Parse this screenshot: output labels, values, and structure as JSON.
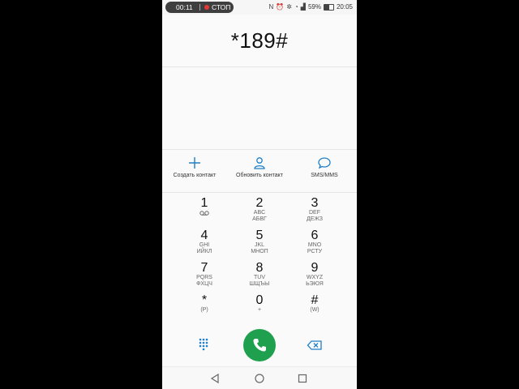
{
  "status_bar": {
    "rec_time": "00:11",
    "rec_stop": "СТОП",
    "battery": "59%",
    "clock": "20:05"
  },
  "display": {
    "number": "*189#"
  },
  "actions": [
    {
      "label": "Создать контакт",
      "icon": "plus-icon"
    },
    {
      "label": "Обновить контакт",
      "icon": "person-icon"
    },
    {
      "label": "SMS/MMS",
      "icon": "chat-bubble-icon"
    }
  ],
  "keypad": [
    {
      "digit": "1",
      "sub1": "",
      "sub2": ""
    },
    {
      "digit": "2",
      "sub1": "ABC",
      "sub2": "АБВГ"
    },
    {
      "digit": "3",
      "sub1": "DEF",
      "sub2": "ДЕЖЗ"
    },
    {
      "digit": "4",
      "sub1": "GHI",
      "sub2": "ИЙКЛ"
    },
    {
      "digit": "5",
      "sub1": "JKL",
      "sub2": "МНОП"
    },
    {
      "digit": "6",
      "sub1": "MNO",
      "sub2": "РСТУ"
    },
    {
      "digit": "7",
      "sub1": "PQRS",
      "sub2": "ФХЦЧ"
    },
    {
      "digit": "8",
      "sub1": "TUV",
      "sub2": "ШЩЪЫ"
    },
    {
      "digit": "9",
      "sub1": "WXYZ",
      "sub2": "ЬЭЮЯ"
    },
    {
      "digit": "*",
      "sub1": "(P)",
      "sub2": ""
    },
    {
      "digit": "0",
      "sub1": "+",
      "sub2": ""
    },
    {
      "digit": "#",
      "sub1": "(W)",
      "sub2": ""
    }
  ],
  "colors": {
    "accent": "#1e7fc8",
    "call": "#1ea04e"
  }
}
